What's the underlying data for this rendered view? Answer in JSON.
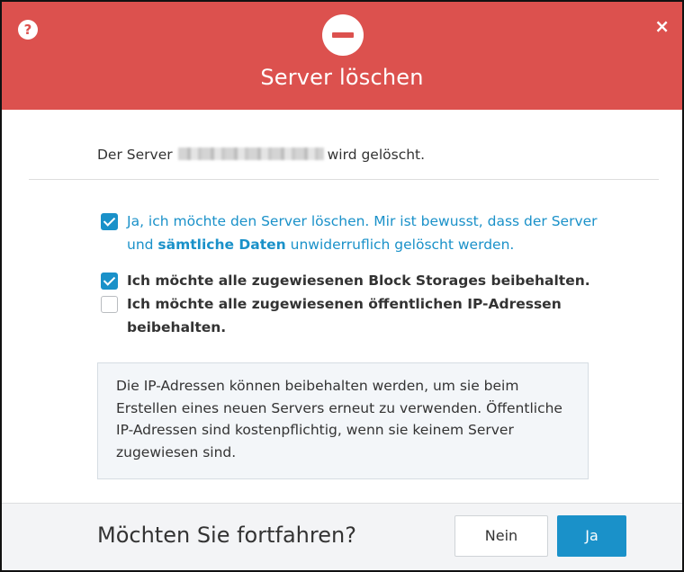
{
  "header": {
    "title": "Server löschen",
    "help_icon": "?",
    "close_icon": "×",
    "accent_color": "#dc514e"
  },
  "intro": {
    "prefix": "Der Server",
    "suffix": "wird gelöscht."
  },
  "options": {
    "confirm_delete": {
      "checked": true,
      "text_part1": "Ja, ich möchte den Server löschen. Mir ist bewusst, dass der Server und ",
      "text_bold": "sämtliche Daten",
      "text_part2": " unwiderruflich gelöscht werden."
    },
    "keep_block_storage": {
      "checked": true,
      "text": "Ich möchte alle zugewiesenen Block Storages beibehalten."
    },
    "keep_public_ips": {
      "checked": false,
      "text": "Ich möchte alle zugewiesenen öffentlichen IP-Adressen beibehalten."
    }
  },
  "info": {
    "text": "Die IP-Adressen können beibehalten werden, um sie beim Erstellen eines neuen Servers erneut zu verwenden. Öffentliche IP-Adressen sind kostenpflichtig, wenn sie keinem Server zugewiesen sind."
  },
  "footer": {
    "question": "Möchten Sie fortfahren?",
    "no_label": "Nein",
    "yes_label": "Ja",
    "primary_color": "#1a91c9"
  }
}
